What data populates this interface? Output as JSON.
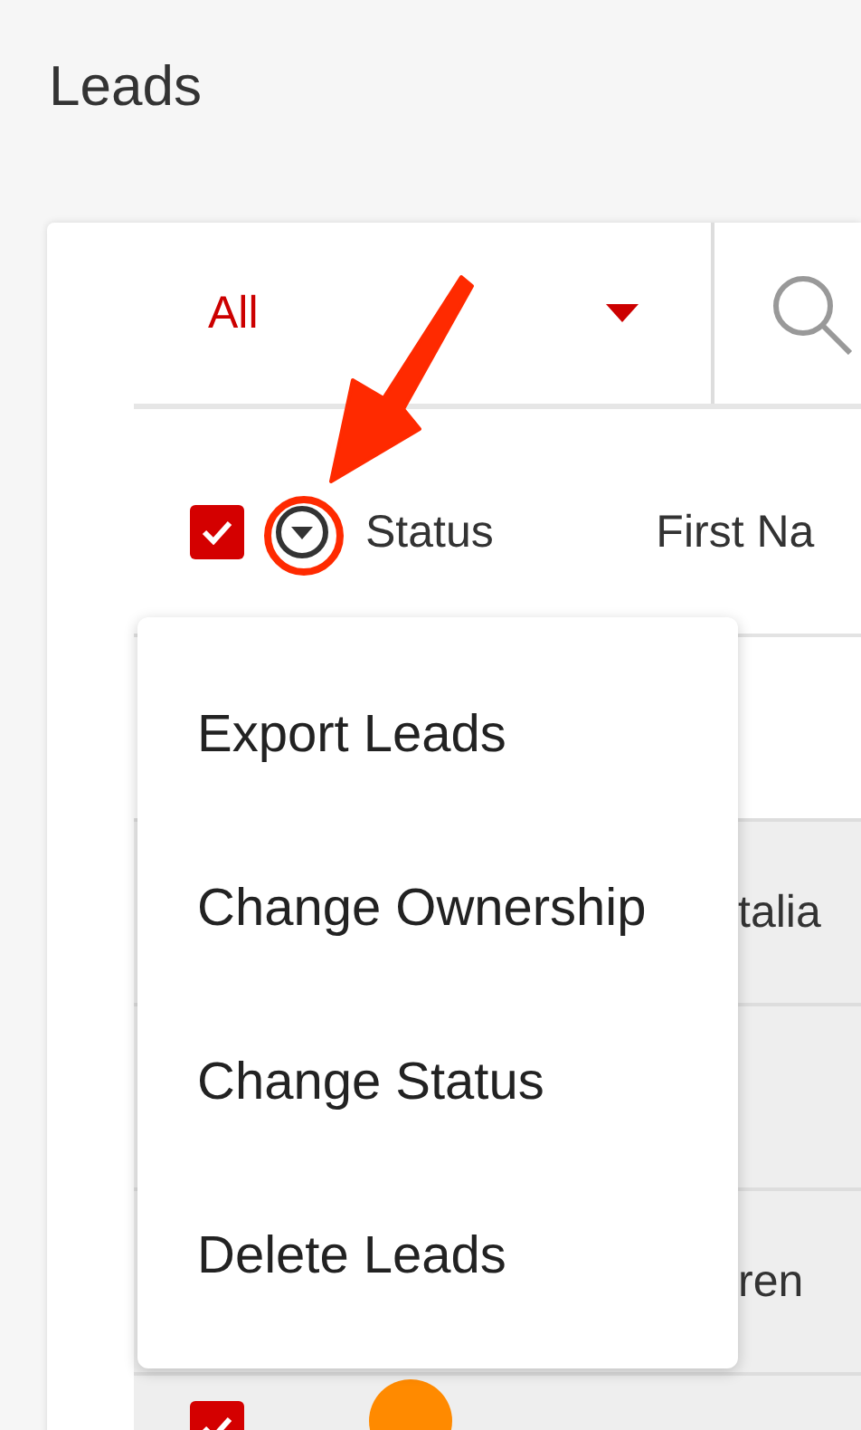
{
  "page_title": "Leads",
  "filter": {
    "label": "All"
  },
  "table": {
    "header": {
      "checked": true,
      "columns": [
        "Status",
        "First Na"
      ]
    },
    "rows": [
      {
        "selected": false
      },
      {
        "selected": true,
        "first_name": "talia"
      },
      {
        "selected": true
      },
      {
        "selected": true,
        "first_name": "ren"
      },
      {
        "selected": true,
        "checked": true,
        "avatar": true
      }
    ]
  },
  "menu": {
    "items": [
      "Export Leads",
      "Change Ownership",
      "Change Status",
      "Delete Leads"
    ]
  }
}
